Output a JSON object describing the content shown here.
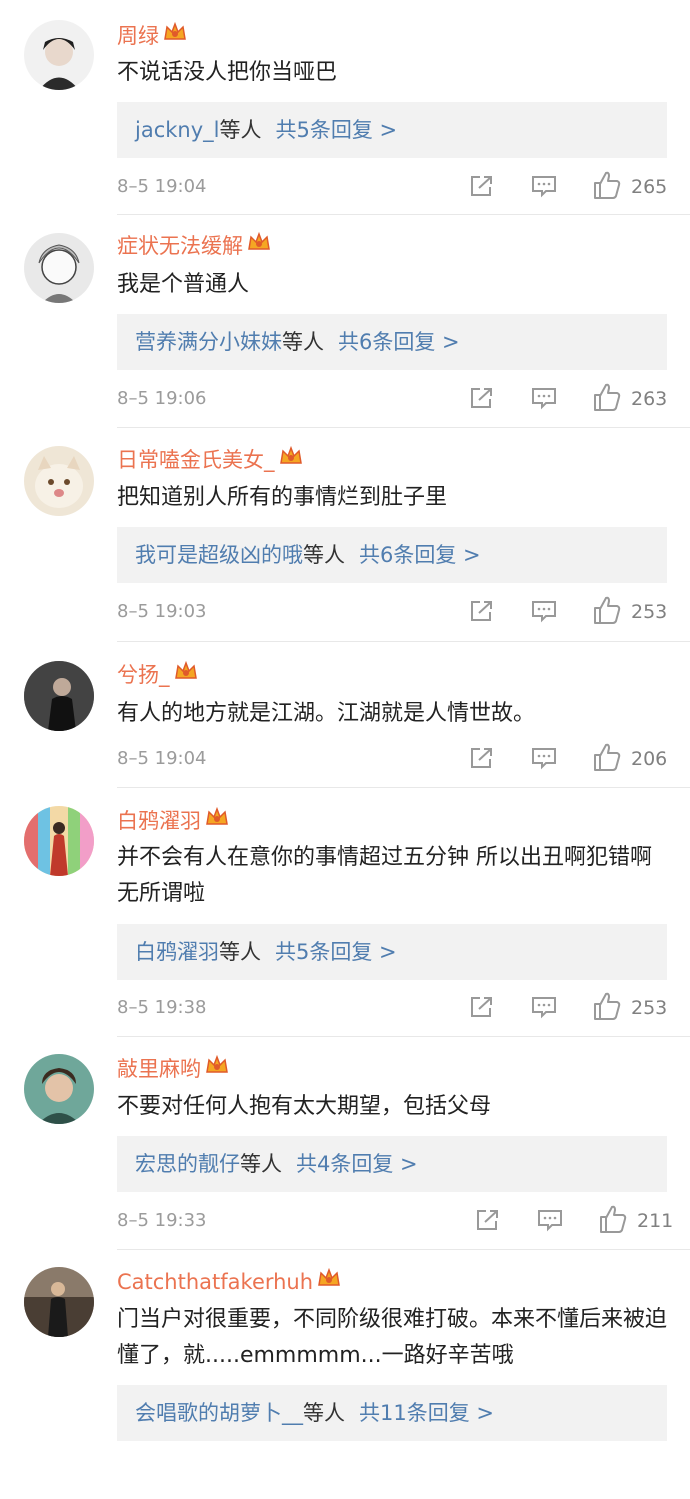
{
  "comments": [
    {
      "user": "周绿",
      "text": "不说话没人把你当哑巴",
      "reply_users": "jackny_l",
      "reply_suffix": "等人",
      "reply_count": "共5条回复 >",
      "time": "8–5 19:04",
      "likes": "265",
      "avatar_color": "#2b2b2b"
    },
    {
      "user": "症状无法缓解",
      "text": "我是个普通人",
      "reply_users": "营养满分小妹妹",
      "reply_suffix": "等人",
      "reply_count": "共6条回复 >",
      "time": "8–5 19:06",
      "likes": "263",
      "avatar_color": "#cfcfcf"
    },
    {
      "user": "日常嗑金氏美女_",
      "text": "把知道别人所有的事情烂到肚子里",
      "reply_users": "我可是超级凶的哦",
      "reply_suffix": "等人",
      "reply_count": "共6条回复 >",
      "time": "8–5 19:03",
      "likes": "253",
      "avatar_color": "#e9ddc8"
    },
    {
      "user": "兮扬_",
      "text": "有人的地方就是江湖。江湖就是人情世故。",
      "time": "8–5 19:04",
      "likes": "206",
      "avatar_color": "#3a3a3a"
    },
    {
      "user": "白鸦濯羽",
      "text": "并不会有人在意你的事情超过五分钟 所以出丑啊犯错啊 无所谓啦",
      "reply_users": "白鸦濯羽",
      "reply_suffix": "等人",
      "reply_count": "共5条回复 >",
      "time": "8–5 19:38",
      "likes": "253",
      "avatar_color": "#d96a6a"
    },
    {
      "user": "敲里麻哟",
      "text": "不要对任何人抱有太大期望，包括父母",
      "reply_users": "宏思的靓仔",
      "reply_suffix": "等人",
      "reply_count": "共4条回复 >",
      "time": "8–5 19:33",
      "likes": "211",
      "avatar_color": "#4f8a7f"
    },
    {
      "user": "Catchthatfakerhuh",
      "text": "门当户对很重要，不同阶级很难打破。本来不懂后来被迫懂了，就.....emmmmm...一路好辛苦哦",
      "reply_users": "会唱歌的胡萝卜__",
      "reply_suffix": "等人",
      "reply_count": "共11条回复 >",
      "avatar_color": "#6b5a4a"
    }
  ],
  "icons": {
    "crown": "vip-crown-icon",
    "share": "share-icon",
    "comment": "comment-icon",
    "like": "thumbs-up-icon"
  },
  "colors": {
    "username": "#eb7350",
    "reply_link": "#507daf",
    "reply_bg": "#f2f2f2",
    "meta": "#9b9b9b"
  }
}
